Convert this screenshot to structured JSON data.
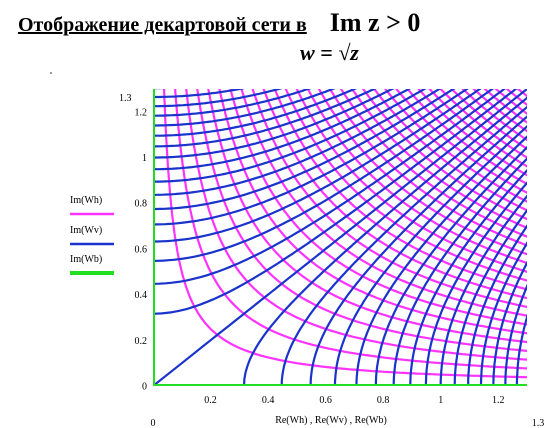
{
  "heading": {
    "title": "Отображение декартовой сети в",
    "condition": "Im z > 0",
    "formula": "w = √z"
  },
  "chart_data": {
    "type": "line",
    "title": "Отображение декартовой сети в Im z > 0",
    "subtitle": "w = √z",
    "xlabel": "Re(Wh) , Re(Wv) , Re(Wb)",
    "ylabel": "",
    "xlim": [
      0,
      1.3
    ],
    "ylim": [
      0,
      1.3
    ],
    "x_ticks": [
      "0",
      "0.2",
      "0.4",
      "0.6",
      "0.8",
      "1",
      "1.2"
    ],
    "y_ticks": [
      "0",
      "0.2",
      "0.4",
      "0.6",
      "0.8",
      "1",
      "1.2"
    ],
    "x_min_label": "0",
    "x_max_label": "1.3",
    "y_max_label": "1.3",
    "grid": false,
    "legend_position": "left",
    "series": [
      {
        "name": "Im(Wh)",
        "color": "#ff33ff",
        "description": "images of horizontal lines Im z = c",
        "c_values": [
          0.1,
          0.2,
          0.3,
          0.4,
          0.5,
          0.6,
          0.7,
          0.8,
          0.9,
          1.0,
          1.1,
          1.2,
          1.3,
          1.4,
          1.5,
          1.6,
          1.7,
          1.8,
          1.9,
          2.0,
          2.1,
          2.2,
          2.3,
          2.4,
          2.5,
          2.6,
          2.7,
          2.8,
          2.9,
          3.0,
          3.1,
          3.2,
          3.3,
          3.4
        ]
      },
      {
        "name": "Im(Wv)",
        "color": "#1a33cc",
        "description": "images of vertical lines Re z = c",
        "c_values": [
          -1.7,
          -1.6,
          -1.5,
          -1.4,
          -1.3,
          -1.2,
          -1.1,
          -1.0,
          -0.9,
          -0.8,
          -0.7,
          -0.6,
          -0.5,
          -0.4,
          -0.3,
          -0.2,
          -0.1,
          0.0,
          0.1,
          0.2,
          0.3,
          0.4,
          0.5,
          0.6,
          0.7,
          0.8,
          0.9,
          1.0,
          1.1,
          1.2,
          1.3,
          1.4,
          1.5,
          1.6
        ]
      },
      {
        "name": "Im(Wb)",
        "color": "#22dd22",
        "description": "image of the real axis Im z = 0"
      }
    ]
  }
}
